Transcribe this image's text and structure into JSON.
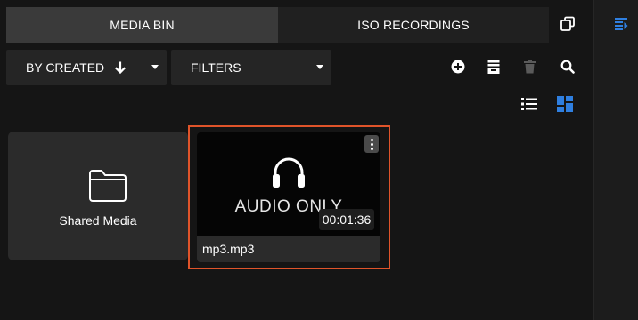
{
  "tabs": [
    {
      "label": "MEDIA BIN",
      "active": true
    },
    {
      "label": "ISO RECORDINGS",
      "active": false
    }
  ],
  "toolbar": {
    "sort_label": "BY CREATED",
    "filter_label": "FILTERS",
    "icons": [
      "add-icon",
      "archive-icon",
      "trash-icon",
      "search-icon"
    ]
  },
  "view": {
    "list_icon": "list-view-icon",
    "grid_icon": "grid-view-icon",
    "selected": "grid"
  },
  "items": [
    {
      "type": "folder",
      "label": "Shared Media"
    },
    {
      "type": "audio",
      "thumb_text": "AUDIO ONLY",
      "duration": "00:01:36",
      "name": "mp3.mp3",
      "selected": true
    }
  ],
  "colors": {
    "accent_blue": "#2f7fe0",
    "selection": "#e0542a",
    "background": "#151515"
  }
}
